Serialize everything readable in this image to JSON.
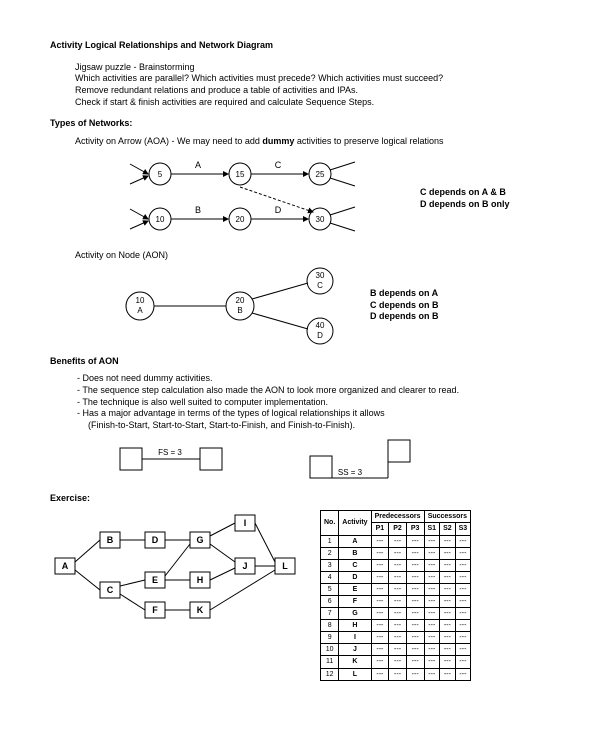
{
  "title": "Activity Logical Relationships and Network Diagram",
  "intro": {
    "l1": "Jigsaw puzzle - Brainstorming",
    "l2": "Which activities are parallel?  Which activities must precede?  Which activities must succeed?",
    "l3": "Remove redundant relations and produce a table of activities and IPAs.",
    "l4": "Check if start & finish activities are required and calculate Sequence Steps."
  },
  "types_label": "Types of Networks:",
  "aoa_line": [
    "Activity on Arrow (AOA) - We may need to add ",
    "dummy",
    " activities to preserve logical relations"
  ],
  "aoa_nodes": {
    "n1": "5",
    "n2": "15",
    "n3": "25",
    "n4": "10",
    "n5": "20",
    "n6": "30"
  },
  "aoa_arrows": {
    "a": "A",
    "b": "B",
    "c": "C",
    "d": "D"
  },
  "aoa_side": {
    "l1": "C depends on A & B",
    "l2": "D depends on B only"
  },
  "aon_label": "Activity on Node (AON)",
  "aon_nodes": {
    "n1t": "10",
    "n1b": "A",
    "n2t": "20",
    "n2b": "B",
    "n3t": "30",
    "n3b": "C",
    "n4t": "40",
    "n4b": "D"
  },
  "aon_side": {
    "l1": "B depends on A",
    "l2": "C depends on B",
    "l3": "D depends on B"
  },
  "benefits_label": "Benefits of AON",
  "benefits": {
    "b1": "Does not need dummy activities.",
    "b2": "The sequence step calculation also made the AON to look more organized and clearer to read.",
    "b3": "The technique is also well suited to computer implementation.",
    "b4": "Has a major advantage in terms of the types of logical relationships it allows",
    "b5": "(Finish-to-Start, Start-to-Start, Start-to-Finish, and Finish-to-Finish)."
  },
  "rel": {
    "fs": "FS = 3",
    "ss": "SS = 3"
  },
  "exercise_label": "Exercise:",
  "ex_nodes": {
    "A": "A",
    "B": "B",
    "C": "C",
    "D": "D",
    "E": "E",
    "F": "F",
    "G": "G",
    "H": "H",
    "I": "I",
    "J": "J",
    "K": "K",
    "L": "L"
  },
  "table": {
    "h_no": "No.",
    "h_act": "Activity",
    "h_pred": "Predecessors",
    "h_succ": "Successors",
    "h_p1": "P1",
    "h_p2": "P2",
    "h_p3": "P3",
    "h_s1": "S1",
    "h_s2": "S2",
    "h_s3": "S3",
    "rows": [
      {
        "no": "1",
        "act": "A"
      },
      {
        "no": "2",
        "act": "B"
      },
      {
        "no": "3",
        "act": "C"
      },
      {
        "no": "4",
        "act": "D"
      },
      {
        "no": "5",
        "act": "E"
      },
      {
        "no": "6",
        "act": "F"
      },
      {
        "no": "7",
        "act": "G"
      },
      {
        "no": "8",
        "act": "H"
      },
      {
        "no": "9",
        "act": "I"
      },
      {
        "no": "10",
        "act": "J"
      },
      {
        "no": "11",
        "act": "K"
      },
      {
        "no": "12",
        "act": "L"
      }
    ],
    "dash": "---"
  }
}
